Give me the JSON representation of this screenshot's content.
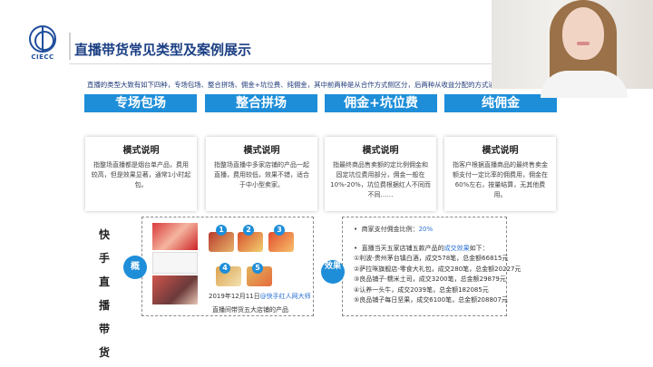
{
  "logo": {
    "text": "CIECC"
  },
  "title": "直播带货常见类型及案例展示",
  "intro": "直播的类型大致有如下四种，专场包场、整合拼场、佣金+坑位费、纯佣金，其中前两种是从合作方式侧区分，后两种从收益分配的方式进行区分。",
  "types": [
    "专场包场",
    "整合拼场",
    "佣金+坑位费",
    "纯佣金"
  ],
  "modes": [
    {
      "title": "模式说明",
      "desc": "指整场直播都是烟台单产品，费用较高，但是效果显著，通常1小时起包。"
    },
    {
      "title": "模式说明",
      "desc": "指整场直播中多家店铺的产品一起直播，费用较低，效果不错，适合于中小型卖家。"
    },
    {
      "title": "模式说明",
      "desc": "指最终商品售卖额的定比例佣金和固定坑位费用部分，佣金一般在10%-20%，坑位费根据红人不同而不同……"
    },
    {
      "title": "模式说明",
      "desc": "指客户根据直播商品的最终售卖金额支付一定比率的佣费用，佣金在60%左右，按量结算，无其他费用。"
    }
  ],
  "vertical_title": [
    "快",
    "手",
    "直",
    "播",
    "带",
    "货"
  ],
  "case": {
    "tag": "概",
    "badges": [
      "1",
      "2",
      "3",
      "4",
      "5"
    ],
    "date": "2019年12月11日",
    "date_highlight": "@快手红人网大师",
    "caption": "直播间带货五大店铺的产品"
  },
  "effect": {
    "tag": "效果",
    "commission_prefix": "商家支付佣金比例：",
    "commission_value": "20%",
    "summary_prefix": "直播当天五家店铺五款产品的",
    "summary_highlight": "成交效果",
    "summary_suffix": "如下：",
    "items": [
      "①利波-贵州茅台镇白酒，成交578笔，总金额66815元",
      "②萨拉咪旗舰店-零食大礼包，成交280笔，总金额20227元",
      "③良品铺子-糯米土司，成交3200笔，总金额29879元",
      "④认养一头牛，成交2039笔，总金额182085元",
      "⑤良品铺子每日坚果，成交6100笔，总金额208807元"
    ]
  },
  "colors": {
    "accent": "#1e8ed9",
    "title": "#1b3f84",
    "highlight": "#2a6fd3"
  }
}
